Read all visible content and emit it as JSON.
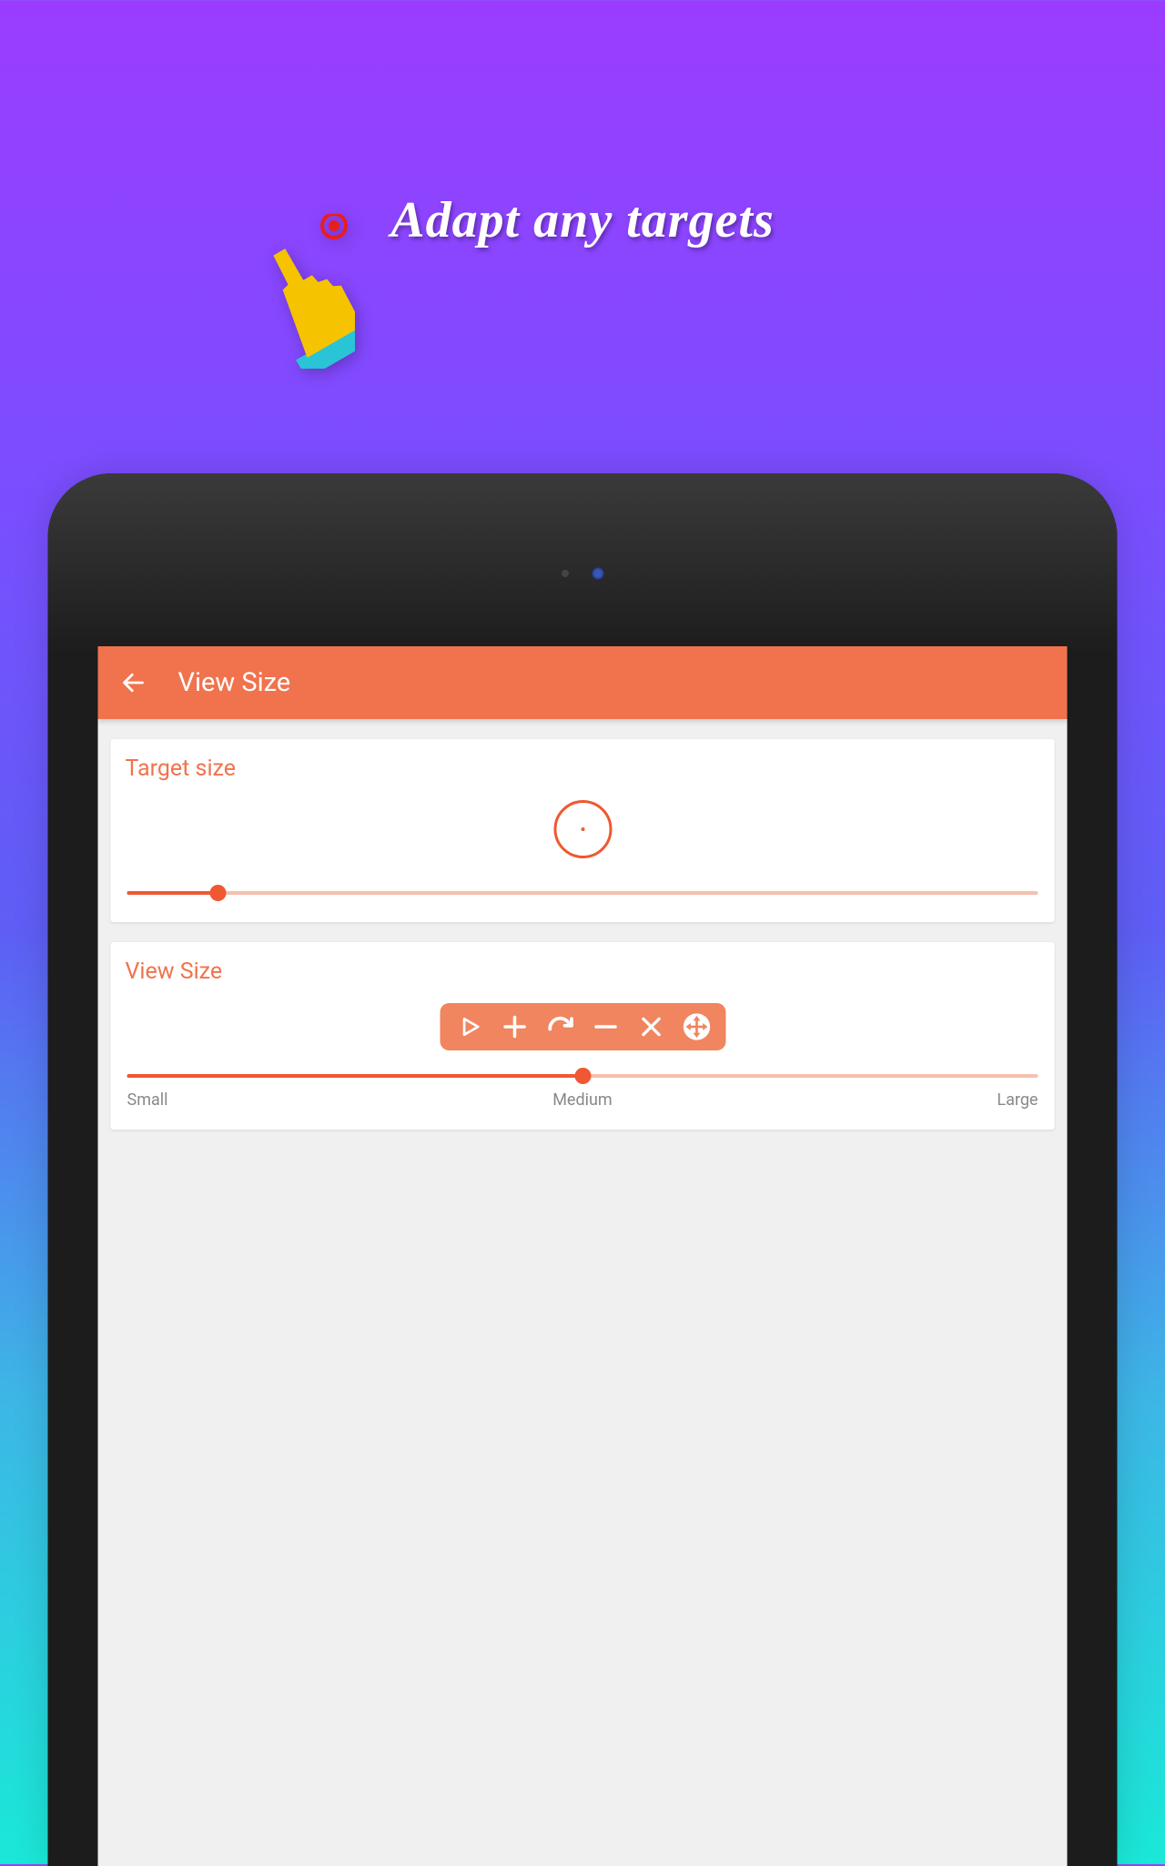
{
  "promo": {
    "title": "Adapt any targets"
  },
  "app": {
    "header_title": "View Size"
  },
  "target_card": {
    "title": "Target size",
    "slider_percent": 10
  },
  "view_card": {
    "title": "View Size",
    "slider_percent": 50,
    "labels": {
      "small": "Small",
      "medium": "Medium",
      "large": "Large"
    }
  }
}
